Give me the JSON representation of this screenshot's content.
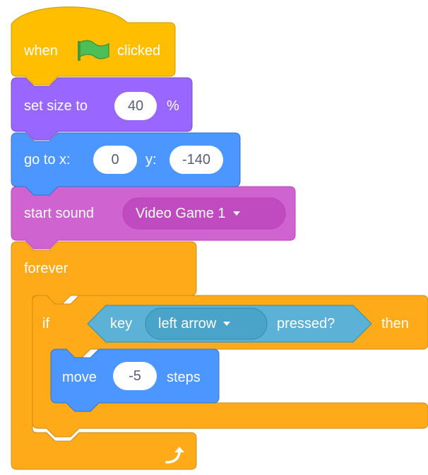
{
  "colors": {
    "events": "#ffbf00",
    "events_border": "#cc9900",
    "looks": "#9966ff",
    "looks_border": "#774dcb",
    "motion": "#4c97ff",
    "motion_border": "#3373cc",
    "sound": "#cf63cf",
    "sound_border": "#bd42bd",
    "control": "#ffab19",
    "control_border": "#cf8b17",
    "sensing": "#5cb1d6",
    "sensing_border": "#2e8eb8",
    "flag": "#4cbf56"
  },
  "script": {
    "hat": {
      "when": "when",
      "icon": "green-flag-icon",
      "clicked": "clicked"
    },
    "set_size": {
      "label": "set size to",
      "value": "40",
      "unit": "%"
    },
    "go_to": {
      "label": "go to x:",
      "x": "0",
      "y_label": "y:",
      "y": "-140"
    },
    "start_sound": {
      "label": "start sound",
      "sound": "Video Game 1"
    },
    "forever": {
      "label": "forever",
      "loop_icon": "loop-arrow-icon"
    },
    "if_block": {
      "if_label": "if",
      "then_label": "then",
      "condition": {
        "key": "key",
        "key_value": "left arrow",
        "pressed": "pressed?"
      }
    },
    "move": {
      "label": "move",
      "value": "-5",
      "unit": "steps"
    }
  }
}
